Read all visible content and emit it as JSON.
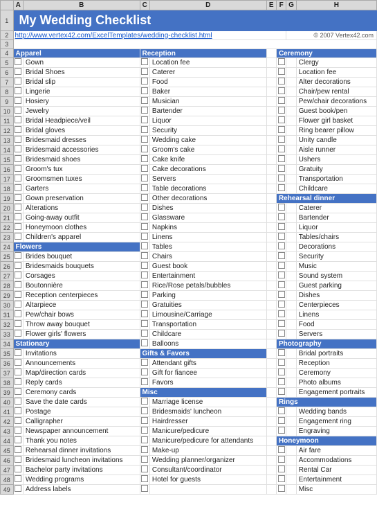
{
  "title": "My Wedding Checklist",
  "url": "http://www.vertex42.com/ExcelTemplates/wedding-checklist.html",
  "copyright": "© 2007 Vertex42.com",
  "columns": [
    "A",
    "B",
    "C",
    "D",
    "E",
    "F",
    "G",
    "H"
  ],
  "col_headers": [
    "A",
    "B",
    "C",
    "D",
    "E",
    "F",
    "G",
    "H"
  ],
  "rows": [
    {
      "r": 1,
      "col1_sec": true,
      "col1": "My Wedding Checklist",
      "col2_sec": false,
      "col2": "",
      "col3_sec": false,
      "col3": "",
      "col4_sec": false,
      "col4": ""
    },
    {
      "r": 2,
      "col1_url": true,
      "col1": "http://www.vertex42.com/ExcelTemplates/wedding-checklist.html",
      "col2": "",
      "col3": "",
      "col4_copy": true,
      "col4": "© 2007 Vertex42.com"
    },
    {
      "r": 3,
      "col1": "",
      "col2": "",
      "col3": "",
      "col4": ""
    },
    {
      "r": 4,
      "col1_sec": true,
      "col1": "Apparel",
      "col2_sec": true,
      "col2": "Reception",
      "col3_sec": true,
      "col3": "Ceremony"
    },
    {
      "r": 5,
      "col1": "Gown",
      "col2": "Location fee",
      "col3": "Clergy"
    },
    {
      "r": 6,
      "col1": "Bridal Shoes",
      "col2": "Caterer",
      "col3": "Location fee"
    },
    {
      "r": 7,
      "col1": "Bridal slip",
      "col2": "Food",
      "col3": "Alter decorations"
    },
    {
      "r": 8,
      "col1": "Lingerie",
      "col2": "Baker",
      "col3": "Chair/pew rental"
    },
    {
      "r": 9,
      "col1": "Hosiery",
      "col2": "Musician",
      "col3": "Pew/chair decorations"
    },
    {
      "r": 10,
      "col1": "Jewelry",
      "col2": "Bartender",
      "col3": "Guest book/pen"
    },
    {
      "r": 11,
      "col1": "Bridal Headpiece/veil",
      "col2": "Liquor",
      "col3": "Flower girl basket"
    },
    {
      "r": 12,
      "col1": "Bridal gloves",
      "col2": "Security",
      "col3": "Ring bearer pillow"
    },
    {
      "r": 13,
      "col1": "Bridesmaid dresses",
      "col2": "Wedding cake",
      "col3": "Unity candle"
    },
    {
      "r": 14,
      "col1": "Bridesmaid accessories",
      "col2": "Groom's cake",
      "col3": "Aisle runner"
    },
    {
      "r": 15,
      "col1": "Bridesmaid shoes",
      "col2": "Cake knife",
      "col3": "Ushers"
    },
    {
      "r": 16,
      "col1": "Groom's tux",
      "col2": "Cake decorations",
      "col3": "Gratuity"
    },
    {
      "r": 17,
      "col1": "Groomsmen tuxes",
      "col2": "Servers",
      "col3": "Transportation"
    },
    {
      "r": 18,
      "col1": "Garters",
      "col2": "Table decorations",
      "col3": "Childcare"
    },
    {
      "r": 19,
      "col1": "Gown preservation",
      "col2": "Other decorations",
      "col3_sec": true,
      "col3": "Rehearsal dinner"
    },
    {
      "r": 20,
      "col1": "Alterations",
      "col2": "Dishes",
      "col3": "Caterer"
    },
    {
      "r": 21,
      "col1": "Going-away outfit",
      "col2": "Glassware",
      "col3": "Bartender"
    },
    {
      "r": 22,
      "col1": "Honeymoon clothes",
      "col2": "Napkins",
      "col3": "Liquor"
    },
    {
      "r": 23,
      "col1": "Children's apparel",
      "col2": "Linens",
      "col3": "Tables/chairs"
    },
    {
      "r": 24,
      "col1_sec": true,
      "col1": "Flowers",
      "col2": "Tables",
      "col3": "Decorations"
    },
    {
      "r": 25,
      "col1": "Brides bouquet",
      "col2": "Chairs",
      "col3": "Security"
    },
    {
      "r": 26,
      "col1": "Bridesmaids bouquets",
      "col2": "Guest book",
      "col3": "Music"
    },
    {
      "r": 27,
      "col1": "Corsages",
      "col2": "Entertainment",
      "col3": "Sound system"
    },
    {
      "r": 28,
      "col1": "Boutonnière",
      "col2": "Rice/Rose petals/bubbles",
      "col3": "Guest parking"
    },
    {
      "r": 29,
      "col1": "Reception centerpieces",
      "col2": "Parking",
      "col3": "Dishes"
    },
    {
      "r": 30,
      "col1": "Altarpiece",
      "col2": "Gratuities",
      "col3": "Centerpieces"
    },
    {
      "r": 31,
      "col1": "Pew/chair bows",
      "col2": "Limousine/Carriage",
      "col3": "Linens"
    },
    {
      "r": 32,
      "col1": "Throw away bouquet",
      "col2": "Transportation",
      "col3": "Food"
    },
    {
      "r": 33,
      "col1": "Flower girls' flowers",
      "col2": "Childcare",
      "col3": "Servers"
    },
    {
      "r": 34,
      "col1_sec": true,
      "col1": "Stationary",
      "col2": "Balloons",
      "col3_sec": true,
      "col3": "Photography"
    },
    {
      "r": 35,
      "col1": "Invitations",
      "col2_sec": true,
      "col2": "Gifts & Favors",
      "col3": "Bridal portraits"
    },
    {
      "r": 36,
      "col1": "Announcements",
      "col2": "Attendant gifts",
      "col3": "Reception"
    },
    {
      "r": 37,
      "col1": "Map/direction cards",
      "col2": "Gift for fiancee",
      "col3": "Ceremony"
    },
    {
      "r": 38,
      "col1": "Reply cards",
      "col2": "Favors",
      "col3": "Photo albums"
    },
    {
      "r": 39,
      "col1": "Ceremony cards",
      "col2_sec": true,
      "col2": "Misc",
      "col3": "Engagement portraits"
    },
    {
      "r": 40,
      "col1": "Save the date cards",
      "col2": "Marriage license",
      "col3_sec": true,
      "col3": "Rings"
    },
    {
      "r": 41,
      "col1": "Postage",
      "col2": "Bridesmaids' luncheon",
      "col3": "Wedding bands"
    },
    {
      "r": 42,
      "col1": "Calligrapher",
      "col2": "Hairdresser",
      "col3": "Engagement ring"
    },
    {
      "r": 43,
      "col1": "Newspaper announcement",
      "col2": "Manicure/pedicure",
      "col3": "Engraving"
    },
    {
      "r": 44,
      "col1": "Thank you notes",
      "col2": "Manicure/pedicure for attendants",
      "col3_sec": true,
      "col3": "Honeymoon"
    },
    {
      "r": 45,
      "col1": "Rehearsal dinner invitations",
      "col2": "Make-up",
      "col3": "Air fare"
    },
    {
      "r": 46,
      "col1": "Bridesmaid luncheon invitations",
      "col2": "Wedding planner/organizer",
      "col3": "Accommodations"
    },
    {
      "r": 47,
      "col1": "Bachelor party invitations",
      "col2": "Consultant/coordinator",
      "col3": "Rental Car"
    },
    {
      "r": 48,
      "col1": "Wedding programs",
      "col2": "Hotel for guests",
      "col3": "Entertainment"
    },
    {
      "r": 49,
      "col1": "Address labels",
      "col2": "",
      "col3": "Misc"
    }
  ]
}
